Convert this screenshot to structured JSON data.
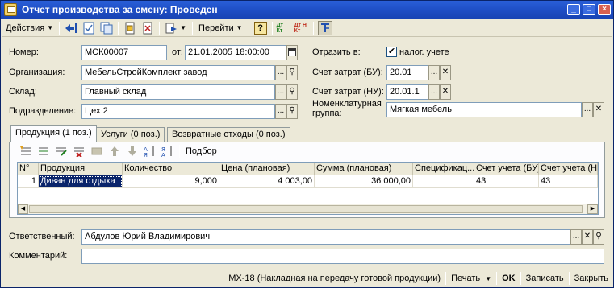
{
  "window": {
    "title": "Отчет производства за смену: Проведен",
    "controls": [
      "_",
      "□",
      "×"
    ]
  },
  "toolbar": {
    "actions_label": "Действия",
    "goto_label": "Перейти",
    "help_label": "?",
    "dt_kt_1": "Дт Кт",
    "dt_kt_2": "Дт Н Кт"
  },
  "form": {
    "number_label": "Номер:",
    "number_value": "МСК00007",
    "date_label": "от:",
    "date_value": "21.01.2005 18:00:00",
    "organization_label": "Организация:",
    "organization_value": "МебельСтройКомплект завод",
    "warehouse_label": "Склад:",
    "warehouse_value": "Главный склад",
    "department_label": "Подразделение:",
    "department_value": "Цех 2",
    "reflect_label": "Отразить в:",
    "tax_accounting_label": "налог. учете",
    "tax_accounting_checked": true,
    "cost_account_bu_label": "Счет затрат (БУ):",
    "cost_account_bu_value": "20.01",
    "cost_account_nu_label": "Счет затрат (НУ):",
    "cost_account_nu_value": "20.01.1",
    "nomenclature_group_label_1": "Номенклатурная",
    "nomenclature_group_label_2": "группа:",
    "nomenclature_group_value": "Мягкая мебель"
  },
  "tabs": [
    {
      "label": "Продукция (1 поз.)",
      "active": true
    },
    {
      "label": "Услуги (0 поз.)",
      "active": false
    },
    {
      "label": "Возвратные отходы (0 поз.)",
      "active": false
    }
  ],
  "table_toolbar": {
    "selection_label": "Подбор"
  },
  "table": {
    "columns": [
      "N°",
      "Продукция",
      "Количество",
      "Цена (плановая)",
      "Сумма (плановая)",
      "Спецификац...",
      "Счет учета (БУ)",
      "Счет учета (НУ"
    ],
    "rows": [
      [
        "1",
        "Диван для отдыха",
        "9,000",
        "4 003,00",
        "36 000,00",
        "",
        "43",
        "43"
      ]
    ]
  },
  "footer": {
    "responsible_label": "Ответственный:",
    "responsible_value": "Абдулов Юрий Владимирович",
    "comment_label": "Комментарий:",
    "comment_value": ""
  },
  "bottom": {
    "print_form": "МХ-18 (Накладная на передачу готовой продукции)",
    "print": "Печать",
    "ok": "OK",
    "save": "Записать",
    "close": "Закрыть"
  }
}
